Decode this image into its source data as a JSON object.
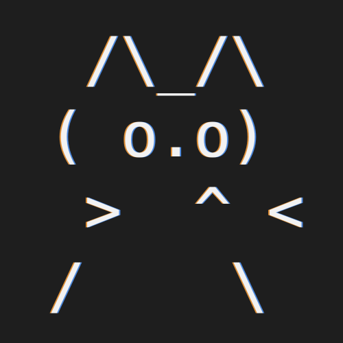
{
  "ascii_cat": {
    "lines": [
      " /\\_/\\",
      "( o.o)",
      " >  ^ <",
      "/    \\"
    ]
  },
  "colors": {
    "background": "#1e1e1e",
    "text": "#f2f2f2",
    "fringe_left": "#ffa33d",
    "fringe_right": "#569cff"
  }
}
